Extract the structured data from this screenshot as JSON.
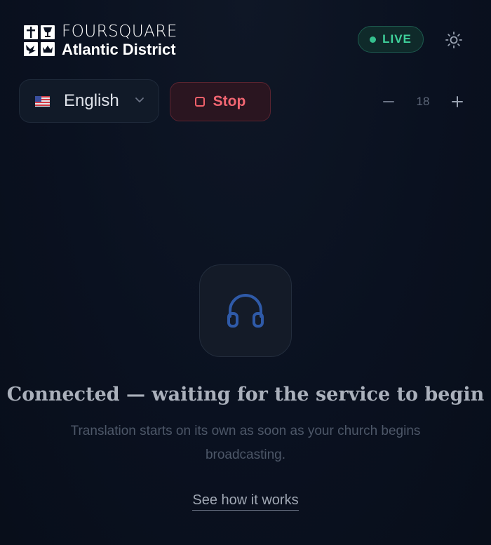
{
  "brand": {
    "line1": "FOURSQUARE",
    "line2": "Atlantic District",
    "logo_icons": [
      "cross-icon",
      "chalice-icon",
      "dove-icon",
      "crown-icon"
    ]
  },
  "status_badge": {
    "label": "LIVE",
    "color": "#3fd19b"
  },
  "theme_toggle": {
    "icon": "sun-icon"
  },
  "language_select": {
    "flag": "us-flag-icon",
    "selected": "English"
  },
  "stop_button": {
    "label": "Stop",
    "color": "#f26672"
  },
  "font_size": {
    "value": "18",
    "decrease_icon": "minus-icon",
    "increase_icon": "plus-icon"
  },
  "empty_state": {
    "icon": "headphones-icon",
    "title": "Connected — waiting for the service to begin",
    "subtitle": "Translation starts on its own as soon as your church begins broadcasting.",
    "link": "See how it works"
  }
}
